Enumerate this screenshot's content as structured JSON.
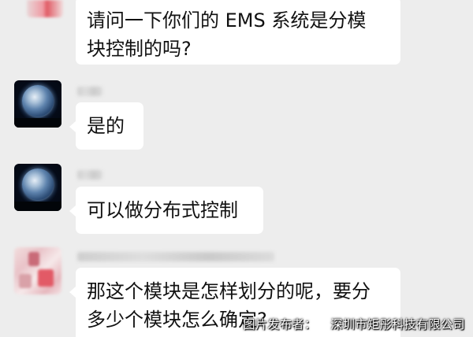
{
  "messages": [
    {
      "sender": "contact-blurred",
      "lines": [
        "请问一下你们的 EMS 系统是分模",
        "块控制的吗?"
      ]
    },
    {
      "sender": "contact-earth",
      "lines": [
        "是的"
      ]
    },
    {
      "sender": "contact-earth",
      "lines": [
        "可以做分布式控制"
      ]
    },
    {
      "sender": "contact-blurred",
      "lines": [
        "那这个模块是怎样划分的呢，要分",
        "多少个模块怎么确定?"
      ]
    }
  ],
  "watermark": {
    "label": "图片发布者：",
    "company": "深圳市矩彤科技有限公司"
  },
  "colors": {
    "background": "#ededed",
    "bubble": "#ffffff",
    "text": "#111111"
  },
  "icons": {
    "earth_avatar": "earth-avatar",
    "blurred_avatar": "blurred-avatar"
  }
}
